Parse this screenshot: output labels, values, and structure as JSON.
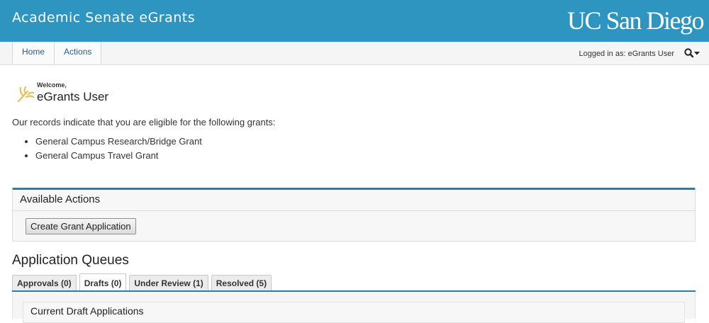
{
  "header": {
    "app_title": "Academic Senate eGrants",
    "logo_text": "UC San Diego",
    "background_color": "#2e95c1"
  },
  "nav": {
    "items": [
      {
        "label": "Home"
      },
      {
        "label": "Actions"
      }
    ],
    "logged_in_text": "Logged in as: eGrants User",
    "search_icon": "search-icon",
    "caret_icon": "caret-down-icon"
  },
  "welcome": {
    "greeting": "Welcome,",
    "user_name": "eGrants User",
    "icon": "trident-icon",
    "icon_color": "#e8c05a"
  },
  "eligibility": {
    "intro": "Our records indicate that you are eligible for the following grants:",
    "grants": [
      "General Campus Research/Bridge Grant",
      "General Campus Travel Grant"
    ]
  },
  "available_actions": {
    "title": "Available Actions",
    "create_button": "Create Grant Application",
    "accent_color": "#2a7db0"
  },
  "queues": {
    "title": "Application Queues",
    "tabs": [
      {
        "label": "Approvals (0)",
        "active": false
      },
      {
        "label": "Drafts (0)",
        "active": true
      },
      {
        "label": "Under Review (1)",
        "active": false
      },
      {
        "label": "Resolved (5)",
        "active": false
      }
    ],
    "panel_title": "Current Draft Applications"
  }
}
